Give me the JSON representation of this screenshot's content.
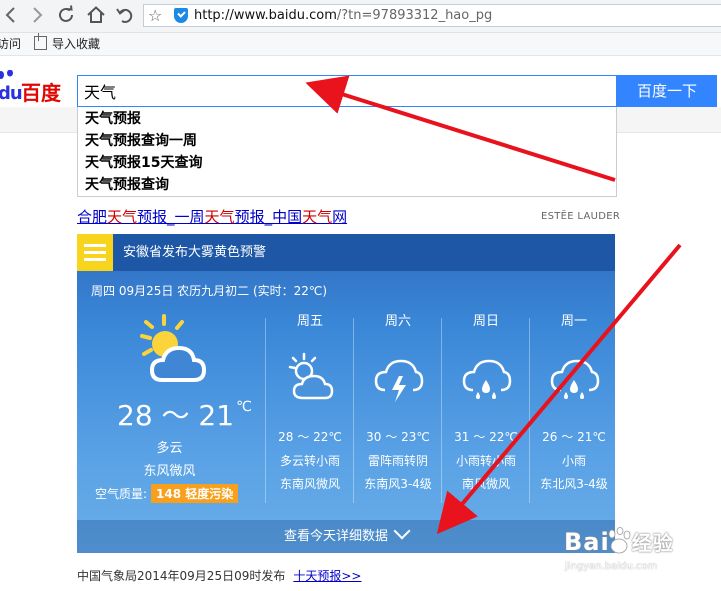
{
  "browser": {
    "url_main": "http://www.baidu.com",
    "url_rest": "/?tn=97893312_hao_pg",
    "bookmark_1": "访问",
    "bookmark_2": "导入收藏"
  },
  "baidu": {
    "logo_du": "du",
    "logo_text": "百度",
    "search_value": "天气",
    "search_button": "百度一下",
    "suggestions": [
      "天气预报",
      "天气预报查询一周",
      "天气预报15天查询",
      "天气预报查询"
    ]
  },
  "result": {
    "title_parts": [
      "合肥",
      "天气",
      "预报_一周",
      "天气",
      "预报_中国",
      "天气",
      "网"
    ],
    "ad_label": "ESTĒE LAUDER",
    "source_text": "中国气象局2014年09月25日09时发布",
    "source_link": "十天预报>>"
  },
  "weather": {
    "alert": "安徽省发布大雾黄色预警",
    "date_line": "周四 09月25日 农历九月初二 (实时：22℃)",
    "today": {
      "temp": "28 ～ 21",
      "unit": "℃",
      "condition": "多云",
      "wind": "东风微风",
      "aq_label": "空气质量:",
      "aq_value": "148 轻度污染"
    },
    "forecast": [
      {
        "day": "周五",
        "icon": "sun-cloud-icon",
        "temp": "28 ～ 22℃",
        "cond": "多云转小雨",
        "wind": "东南风微风"
      },
      {
        "day": "周六",
        "icon": "thunder-cloud-icon",
        "temp": "30 ～ 23℃",
        "cond": "雷阵雨转阴",
        "wind": "东南风3-4级"
      },
      {
        "day": "周日",
        "icon": "rain-cloud-icon",
        "temp": "31 ～ 22℃",
        "cond": "小雨转小雨",
        "wind": "南风微风"
      },
      {
        "day": "周一",
        "icon": "rain-cloud-icon",
        "temp": "26 ～ 21℃",
        "cond": "小雨",
        "wind": "东北风3-4级"
      }
    ],
    "more_label": "查看今天详细数据"
  },
  "watermark": {
    "main": "Bai",
    "main_tail": "经验",
    "sub": "jingyan.baidu.com"
  },
  "colors": {
    "accent": "#3385ff",
    "logo_red": "#e10602",
    "logo_blue": "#2932e1",
    "arrow_red": "#e8131d",
    "badge_orange": "#f8a01c"
  }
}
